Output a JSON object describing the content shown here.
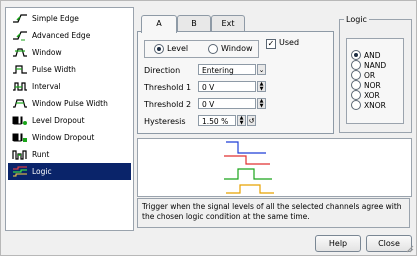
{
  "trigger_types": [
    {
      "label": "Simple Edge",
      "icon": "simple-edge-icon"
    },
    {
      "label": "Advanced Edge",
      "icon": "advanced-edge-icon"
    },
    {
      "label": "Window",
      "icon": "window-icon"
    },
    {
      "label": "Pulse Width",
      "icon": "pulse-width-icon"
    },
    {
      "label": "Interval",
      "icon": "interval-icon"
    },
    {
      "label": "Window Pulse Width",
      "icon": "window-pulse-width-icon"
    },
    {
      "label": "Level Dropout",
      "icon": "level-dropout-icon"
    },
    {
      "label": "Window Dropout",
      "icon": "window-dropout-icon"
    },
    {
      "label": "Runt",
      "icon": "runt-icon"
    },
    {
      "label": "Logic",
      "icon": "logic-icon",
      "selected": true
    }
  ],
  "tabs": [
    "A",
    "B",
    "Ext"
  ],
  "active_tab": "A",
  "channel_a": {
    "mode_level": "Level",
    "mode_window": "Window",
    "used_label": "Used",
    "used_checked": true,
    "direction_label": "Direction",
    "direction_value": "Entering",
    "threshold1_label": "Threshold 1",
    "threshold1_value": "0 V",
    "threshold2_label": "Threshold 2",
    "threshold2_value": "0 V",
    "hysteresis_label": "Hysteresis",
    "hysteresis_value": "1.50 %"
  },
  "logic": {
    "title": "Logic",
    "options": [
      "AND",
      "NAND",
      "OR",
      "NOR",
      "XOR",
      "XNOR"
    ],
    "selected": "AND"
  },
  "description": "Trigger when the signal levels of all the selected channels agree with the chosen logic condition at the same time.",
  "buttons": {
    "help": "Help",
    "close": "Close"
  },
  "colors": {
    "selection": "#0a246a",
    "trace_a": "#1f3fd6",
    "trace_b": "#e03030",
    "trace_c": "#1aa51a",
    "trace_d": "#e8a200",
    "icon_green": "#1aa51a"
  }
}
